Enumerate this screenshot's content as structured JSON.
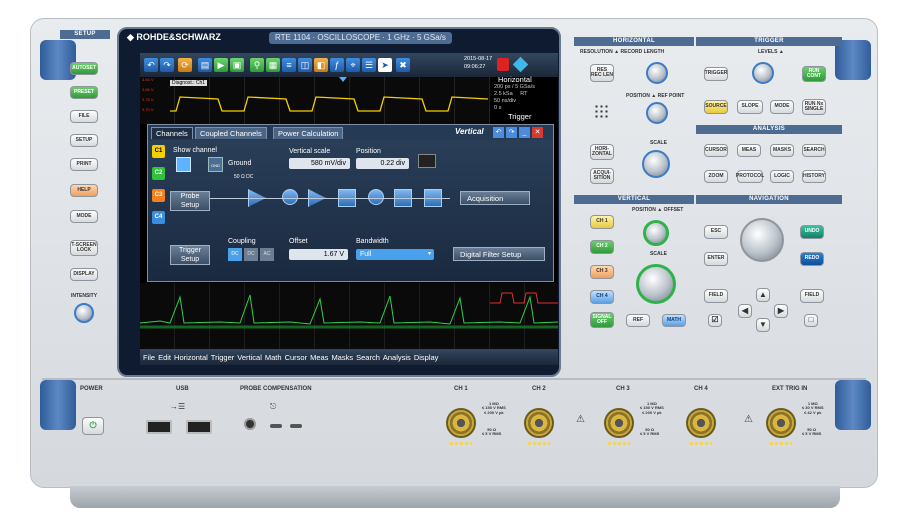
{
  "brand": {
    "name": "ROHDE&SCHWARZ",
    "model": "RTE 1104",
    "type": "OSCILLOSCOPE",
    "bandwidth": "1 GHz",
    "rate": "5 GSa/s"
  },
  "setup": {
    "title": "SETUP",
    "autoset": "AUTOSET",
    "preset": "PRESET",
    "file": "FILE",
    "setup": "SETUP",
    "print": "PRINT",
    "help": "HELP",
    "mode": "MODE",
    "tscreen": "T-SCREEN LOCK",
    "display": "DISPLAY",
    "intensity": "INTENSITY"
  },
  "screen": {
    "date": "2015-08-17",
    "time": "09:06:27",
    "horiz_title": "Horizontal",
    "horiz_lines": [
      "200 ps / 5 GSa/s",
      "2.5 kSa     RT",
      "50 ns/div",
      "0 s"
    ],
    "trigger": "Trigger",
    "diag": "Diagnost.: Ch1",
    "levels": [
      "3.84 V",
      "3.86 V",
      "3.78 V",
      "3.70 V"
    ],
    "dialog": {
      "title": "Vertical",
      "tabs": [
        "Channels",
        "Coupled Channels",
        "Power Calculation"
      ],
      "show_channel": "Show channel",
      "ground": "Ground",
      "gnd": "GND",
      "vscale_label": "Vertical scale",
      "vscale": "580 mV/div",
      "position_label": "Position",
      "position": "0.22 div",
      "ohm": "50 Ω DC",
      "probe_setup": "Probe Setup",
      "acquisition": "Acquisition",
      "trigger_setup": "Trigger Setup",
      "coupling_label": "Coupling",
      "coupling": [
        "DC",
        "DC",
        "AC"
      ],
      "offset_label": "Offset",
      "offset": "1.67 V",
      "bandwidth_label": "Bandwidth",
      "bandwidth": "Full",
      "digital_filter": "Digital Filter Setup",
      "channels": [
        "C1",
        "C2",
        "C3",
        "C4"
      ]
    },
    "menu": [
      "File",
      "Edit",
      "Horizontal",
      "Trigger",
      "Vertical",
      "Math",
      "Cursor",
      "Meas",
      "Masks",
      "Search",
      "Analysis",
      "Display"
    ]
  },
  "horizontal": {
    "title": "HORIZONTAL",
    "resolution": "RESOLUTION",
    "record_length": "RECORD LENGTH",
    "res_rec": "RES REC LEN",
    "position": "POSITION",
    "ref_point": "REF POINT",
    "horizontal": "HORI-ZONTAL",
    "acquisition": "ACQUI-SITION",
    "scale": "SCALE"
  },
  "trigger": {
    "title": "TRIGGER",
    "levels": "LEVELS",
    "trigger": "TRIGGER",
    "run_cont": "RUN CONT",
    "source": "SOURCE",
    "slope": "SLOPE",
    "mode": "MODE",
    "run_single": "RUN Nx SINGLE"
  },
  "analysis": {
    "title": "ANALYSIS",
    "cursor": "CURSOR",
    "meas": "MEAS",
    "masks": "MASKS",
    "search": "SEARCH",
    "zoom": "ZOOM",
    "protocol": "PROTOCOL",
    "logic": "LOGIC",
    "history": "HISTORY"
  },
  "vertical": {
    "title": "VERTICAL",
    "position": "POSITION",
    "offset": "OFFSET",
    "scale": "SCALE",
    "ch1": "CH 1",
    "ch2": "CH 2",
    "ch3": "CH 3",
    "ch4": "CH 4",
    "signal_off": "SIGNAL OFF",
    "ref": "REF",
    "math": "MATH"
  },
  "navigation": {
    "title": "NAVIGATION",
    "esc": "ESC",
    "enter": "ENTER",
    "undo": "UNDO",
    "redo": "REDO",
    "field_left": "FIELD",
    "field_right": "FIELD"
  },
  "front": {
    "power": "POWER",
    "usb": "USB",
    "probe_comp": "PROBE COMPENSATION",
    "ch1": "CH 1",
    "ch2": "CH 2",
    "ch3": "CH 3",
    "ch4": "CH 4",
    "ext": "EXT TRIG IN",
    "spec1": "1 MΩ\n≤ 150 V RMS\n≤ 200 V pk",
    "spec2": "50 Ω\n≤ 5 V RMS",
    "spec_ext": "1 MΩ\n≤ 30 V RMS\n≤ 42 V pk",
    "spec_ext2": "50 Ω\n≤ 5 V RMS"
  }
}
